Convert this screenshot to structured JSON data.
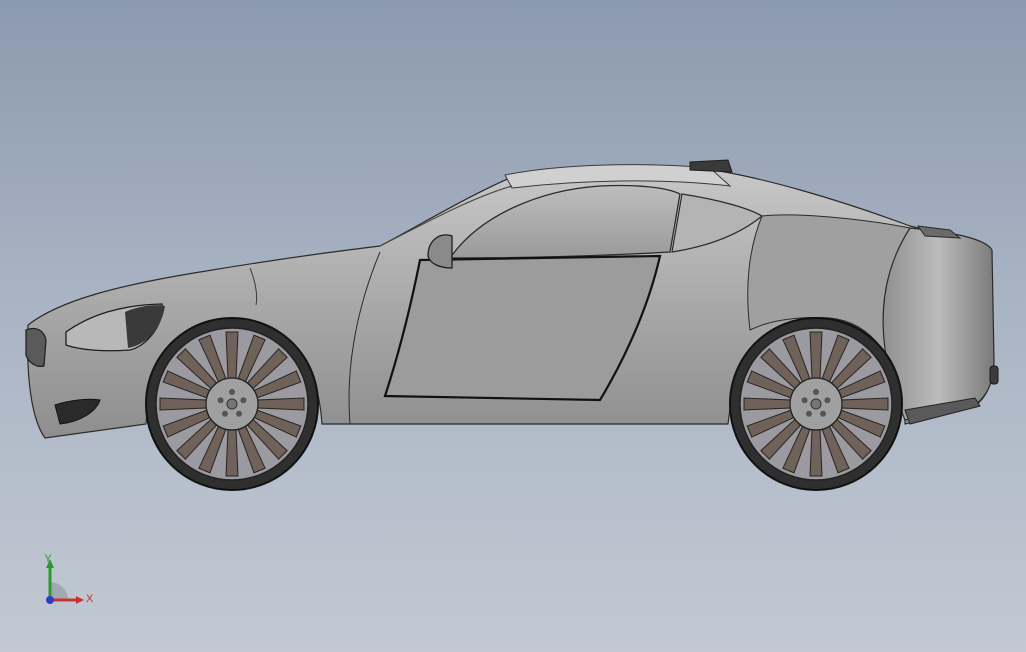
{
  "viewport": {
    "background_top": "#8c9aaf",
    "background_bottom": "#c2c9d3",
    "model_color": "#a3a3a3",
    "wheel_spoke_color": "#6e625a",
    "tire_color": "#3a3a3a"
  },
  "triad": {
    "y_label": "Y",
    "x_label": "X",
    "y_color": "#2a9a2a",
    "x_color": "#c83232",
    "z_color": "#2a3ec8"
  }
}
